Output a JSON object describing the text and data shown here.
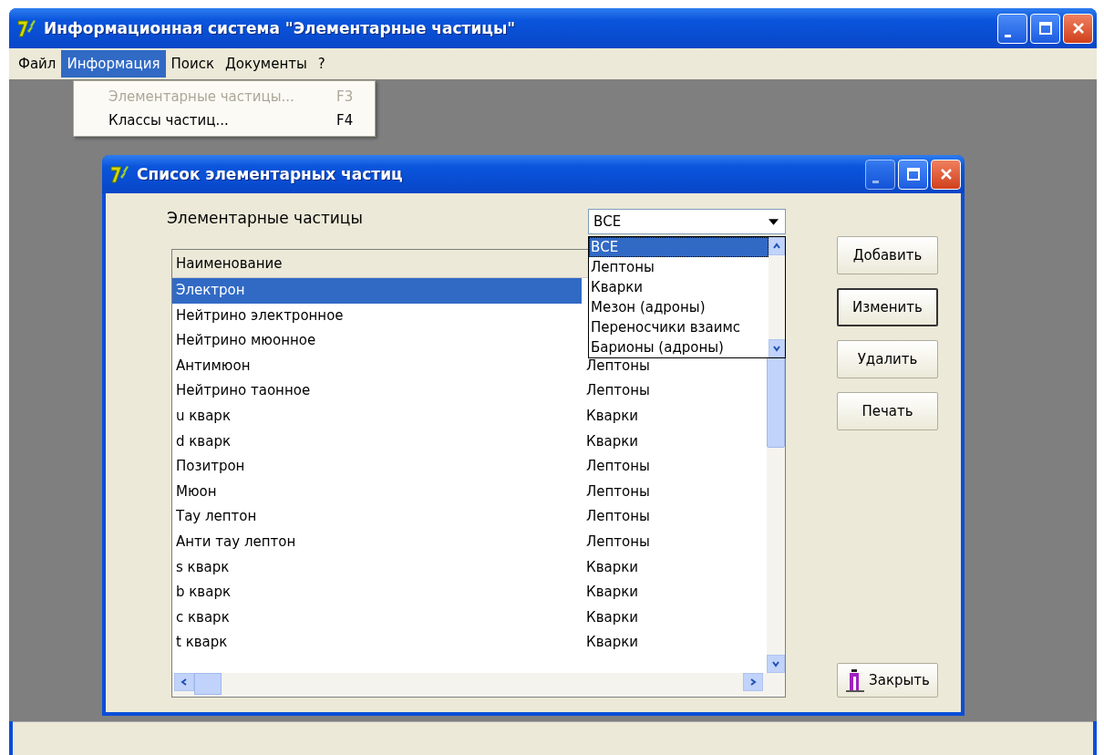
{
  "app_window": {
    "title": "Информационная система \"Элементарные частицы\""
  },
  "menu_bar": [
    {
      "label": "Файл",
      "selected": false
    },
    {
      "label": "Информация",
      "selected": true
    },
    {
      "label": "Поиск",
      "selected": false
    },
    {
      "label": "Документы",
      "selected": false
    },
    {
      "label": "?",
      "selected": false
    }
  ],
  "open_menu": {
    "items": [
      {
        "label": "Элементарные частицы...",
        "shortcut": "F3",
        "disabled": true
      },
      {
        "label": "Классы частиц...",
        "shortcut": "F4",
        "disabled": false
      }
    ]
  },
  "child_window": {
    "title": "Список элементарных частиц",
    "filter_label": "Элементарные частицы",
    "filter": {
      "value": "ВСЕ",
      "options": [
        {
          "label": "ВСЕ",
          "selected": true
        },
        {
          "label": "Лептоны",
          "selected": false
        },
        {
          "label": "Кварки",
          "selected": false
        },
        {
          "label": "Мезон (адроны)",
          "selected": false
        },
        {
          "label": "Переносчики взаимс",
          "selected": false
        },
        {
          "label": "Барионы (адроны)",
          "selected": false
        }
      ]
    },
    "table": {
      "columns": [
        "Наименование"
      ],
      "rows": [
        {
          "name": "Электрон",
          "selected": true
        },
        {
          "name": "Нейтрино электронное",
          "selected": false
        },
        {
          "name": "Нейтрино мюонное",
          "selected": false
        },
        {
          "name": "Антимюон",
          "column_2": "Лептоны",
          "selected": false
        },
        {
          "name": "Нейтрино таонное",
          "column_2": "Лептоны",
          "selected": false
        },
        {
          "name": "u кварк",
          "column_2": "Кварки",
          "selected": false
        },
        {
          "name": "d кварк",
          "column_2": "Кварки",
          "selected": false
        },
        {
          "name": "Позитрон",
          "column_2": "Лептоны",
          "selected": false
        },
        {
          "name": "Мюон",
          "column_2": "Лептоны",
          "selected": false
        },
        {
          "name": "Тау лептон",
          "column_2": "Лептоны",
          "selected": false
        },
        {
          "name": "Анти тау лептон",
          "column_2": "Лептоны",
          "selected": false
        },
        {
          "name": "s кварк",
          "column_2": "Кварки",
          "selected": false
        },
        {
          "name": "b кварк",
          "column_2": "Кварки",
          "selected": false
        },
        {
          "name": "c кварк",
          "column_2": "Кварки",
          "selected": false
        },
        {
          "name": "t кварк",
          "column_2": "Кварки",
          "selected": false
        }
      ]
    },
    "buttons": [
      {
        "label": "Добавить",
        "focused": false
      },
      {
        "label": "Изменить",
        "focused": true
      },
      {
        "label": "Удалить",
        "focused": false
      },
      {
        "label": "Печать",
        "focused": false
      }
    ],
    "close_button": {
      "label": "Закрыть"
    }
  }
}
